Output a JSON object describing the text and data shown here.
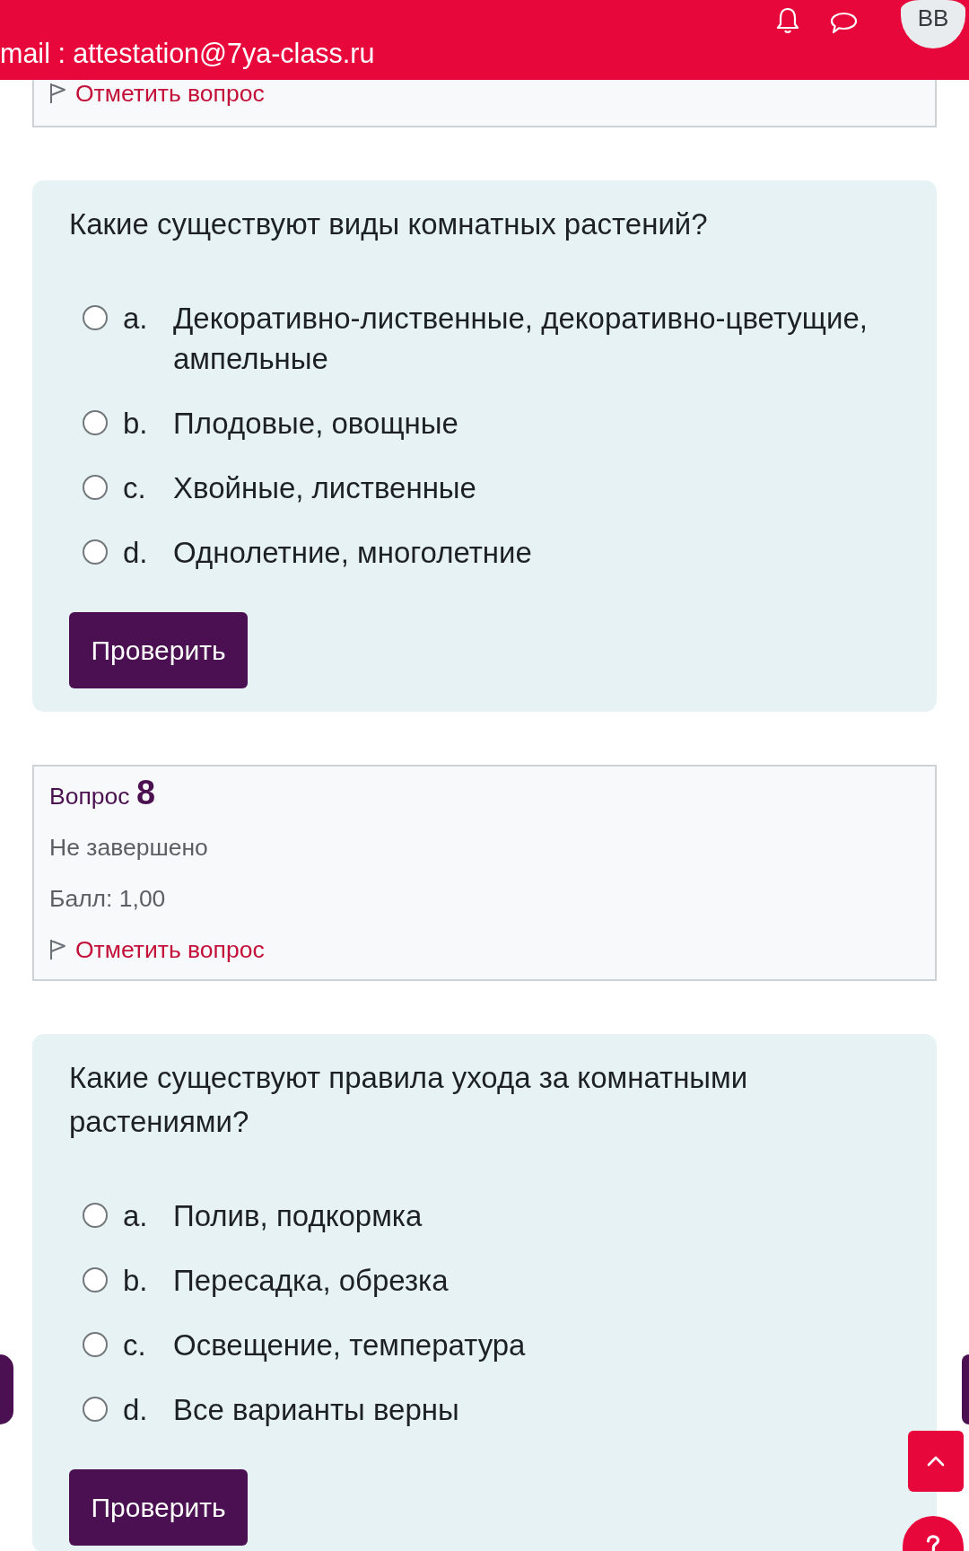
{
  "header": {
    "email": "mail : attestation@7ya-class.ru",
    "avatar": "BB"
  },
  "blocks": [
    {
      "kind": "info_cut",
      "flag": "Отметить вопрос"
    },
    {
      "kind": "formulation",
      "question": "Какие существуют виды комнатных растений?",
      "options": [
        {
          "letter": "a.",
          "text": "Декоративно-лиственные, декоративно-цветущие, ампельные",
          "selected": false
        },
        {
          "letter": "b.",
          "text": "Плодовые, овощные",
          "selected": false
        },
        {
          "letter": "c.",
          "text": "Хвойные, лиственные",
          "selected": false
        },
        {
          "letter": "d.",
          "text": "Однолетние, многолетние",
          "selected": false
        }
      ],
      "button": "Проверить"
    },
    {
      "kind": "info",
      "label": "Вопрос",
      "number": "8",
      "status": "Не завершено",
      "grade": "Балл: 1,00",
      "flag": "Отметить вопрос"
    },
    {
      "kind": "formulation",
      "question": "Какие существуют правила ухода за комнатными растениями?",
      "options": [
        {
          "letter": "a.",
          "text": "Полив, подкормка",
          "selected": false
        },
        {
          "letter": "b.",
          "text": "Пересадка, обрезка",
          "selected": false
        },
        {
          "letter": "c.",
          "text": "Освещение, температура",
          "selected": false
        },
        {
          "letter": "d.",
          "text": "Все варианты верны",
          "selected": false
        }
      ],
      "button": "Проверить"
    }
  ]
}
